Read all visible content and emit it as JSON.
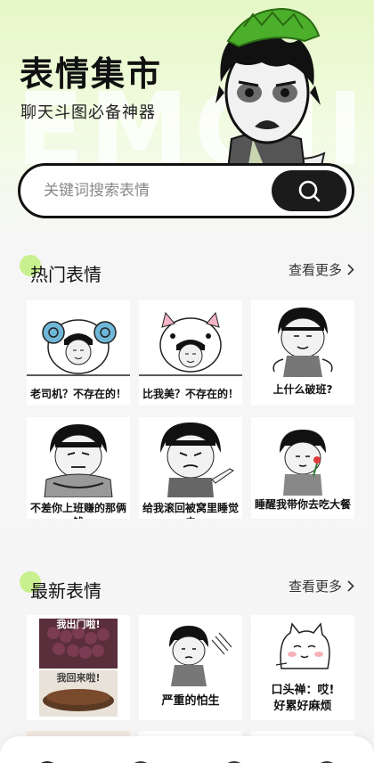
{
  "hero": {
    "title": "表情集市",
    "subtitle": "聊天斗图必备神器",
    "watermark": "EMOJI"
  },
  "search": {
    "placeholder": "关键词搜索表情",
    "button_icon": "search-icon"
  },
  "hot": {
    "title": "热门表情",
    "more": "查看更多",
    "items": [
      {
        "caption": "老司机？不存在的！",
        "icon": "sheep-horn-meme"
      },
      {
        "caption": "比我美？不存在的！",
        "icon": "pig-hood-meme"
      },
      {
        "caption": "上什么破班?",
        "icon": "bowl-cut-shrug-meme"
      },
      {
        "caption": "不差你上班赚的那俩钱",
        "icon": "crossed-arms-meme"
      },
      {
        "caption": "给我滚回被窝里睡觉去",
        "icon": "pointing-meme"
      },
      {
        "caption": "睡醒我带你去吃大餐",
        "icon": "flower-meme"
      }
    ]
  },
  "latest": {
    "title": "最新表情",
    "more": "查看更多",
    "items": [
      {
        "caption_top": "我出门啦!",
        "caption_bottom": "我回来啦!",
        "icon": "grapes-raisins-photo"
      },
      {
        "caption": "严重的怕生",
        "icon": "shy-crouch-meme"
      },
      {
        "caption": "口头禅：哎!\n好累好麻烦",
        "icon": "tired-cat-meme"
      }
    ]
  },
  "colors": {
    "accent": "#c8f08e",
    "dark": "#1b1b1b"
  }
}
